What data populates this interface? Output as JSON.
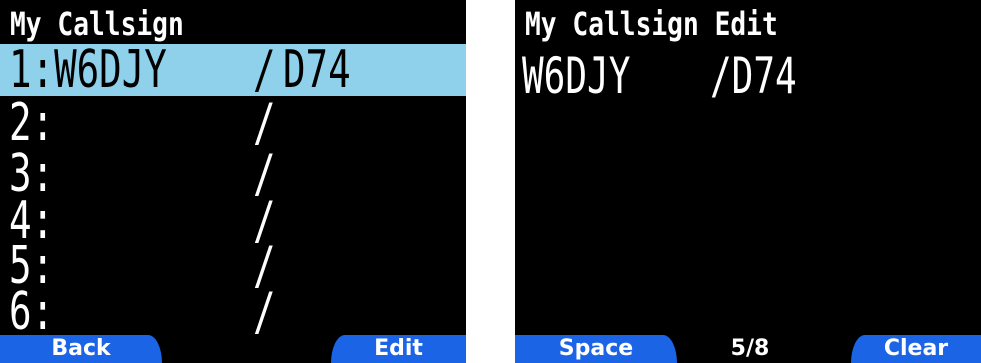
{
  "left_screen": {
    "title": "My Callsign",
    "rows": [
      {
        "label": "1:W6DJY",
        "slash": "/",
        "suffix": "D74",
        "selected": true
      },
      {
        "label": "2:",
        "slash": "/",
        "suffix": "",
        "selected": false
      },
      {
        "label": "3:",
        "slash": "/",
        "suffix": "",
        "selected": false
      },
      {
        "label": "4:",
        "slash": "/",
        "suffix": "",
        "selected": false
      },
      {
        "label": "5:",
        "slash": "/",
        "suffix": "",
        "selected": false
      },
      {
        "label": "6:",
        "slash": "/",
        "suffix": "",
        "selected": false
      }
    ],
    "softkeys": {
      "back": "Back",
      "edit": "Edit"
    }
  },
  "right_screen": {
    "title": "My Callsign Edit",
    "callsign": "W6DJY",
    "suffix": "/D74",
    "softkeys": {
      "space": "Space",
      "clear": "Clear"
    },
    "page_indicator": "5/8"
  },
  "colors": {
    "screen_bg": "#000000",
    "text": "#ffffff",
    "selection": "#8fd0ea",
    "softkey": "#1c64e6"
  }
}
